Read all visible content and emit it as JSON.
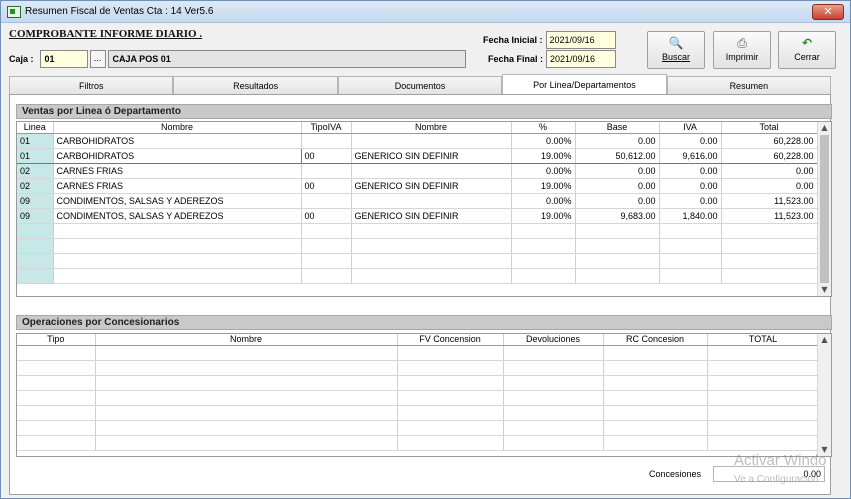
{
  "window": {
    "title": "Resumen Fiscal de Ventas Cta : 14  Ver5.6",
    "close_label": "✕"
  },
  "header": {
    "title": "COMPROBANTE  INFORME DIARIO .",
    "caja_label": "Caja :",
    "caja_code": "01",
    "caja_btn": "...",
    "caja_name": "CAJA POS 01",
    "fecha_inicial_label": "Fecha Inicial :",
    "fecha_inicial": "2021/09/16",
    "fecha_final_label": "Fecha Final :",
    "fecha_final": "2021/09/16"
  },
  "toolbar": {
    "buscar": "Buscar",
    "imprimir": "Imprimir",
    "cerrar": "Cerrar"
  },
  "tabs": [
    "Filtros",
    "Resultados",
    "Documentos",
    "Por Linea/Departamentos",
    "Resumen"
  ],
  "ventas": {
    "title": "Ventas por Linea ó Departamento",
    "columns": [
      "Linea",
      "Nombre",
      "TipoIVA",
      "Nombre",
      "%",
      "Base",
      "IVA",
      "Total"
    ],
    "rows": [
      [
        "01",
        "CARBOHIDRATOS",
        "",
        "",
        "0.00%",
        "0.00",
        "0.00",
        "60,228.00"
      ],
      [
        "01",
        "CARBOHIDRATOS",
        "00",
        "GENERICO SIN DEFINIR",
        "19.00%",
        "50,612.00",
        "9,616.00",
        "60,228.00"
      ],
      [
        "02",
        "CARNES FRIAS",
        "",
        "",
        "0.00%",
        "0.00",
        "0.00",
        "0.00"
      ],
      [
        "02",
        "CARNES FRIAS",
        "00",
        "GENERICO SIN DEFINIR",
        "19.00%",
        "0.00",
        "0.00",
        "0.00"
      ],
      [
        "09",
        "CONDIMENTOS, SALSAS Y ADEREZOS",
        "",
        "",
        "0.00%",
        "0.00",
        "0.00",
        "11,523.00"
      ],
      [
        "09",
        "CONDIMENTOS, SALSAS Y ADEREZOS",
        "00",
        "GENERICO SIN DEFINIR",
        "19.00%",
        "9,683.00",
        "1,840.00",
        "11,523.00"
      ]
    ]
  },
  "concesionarios": {
    "title": "Operaciones por Concesionarios",
    "columns": [
      "Tipo",
      "Nombre",
      "FV Concension",
      "Devoluciones",
      "RC Concesion",
      "TOTAL"
    ]
  },
  "footer": {
    "concesiones_label": "Concesiones",
    "concesiones_value": "0.00"
  },
  "watermark": {
    "line1": "Activar Windo",
    "line2": "Ve a Configuración"
  },
  "colors": {
    "first_col": "#c8e8e8",
    "input_bg": "#ffffe0",
    "section_head": "#c9c9c9"
  }
}
